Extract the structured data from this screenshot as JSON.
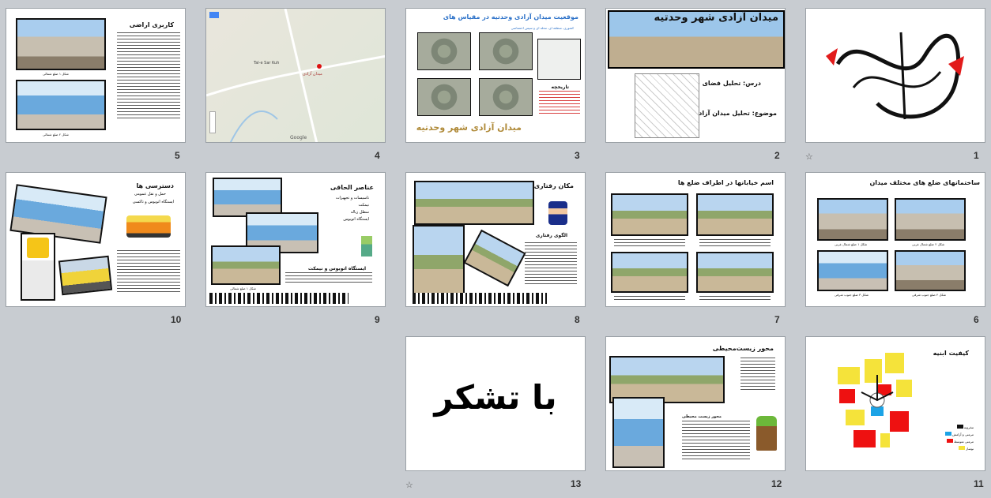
{
  "slides": [
    {
      "n": "1",
      "star": "☆"
    },
    {
      "n": "2",
      "title": "میدان آزادی شهر وحدتیه",
      "line1": "درس: تحلیل فضای شهری",
      "line2": "موضوع: تحلیل میدان آزادی شهر وحدتیه"
    },
    {
      "n": "3",
      "title": "موقعیت میدان آزادی وحدتیه در مقیاس های",
      "subtitle": "کشوری، منطقه ای، محله ای و سپس اختصاصی",
      "history": "تاریخچه",
      "bottom": "میدان آزادی شهر وحدتیه"
    },
    {
      "n": "4",
      "map_city": "Tal-e Sar Kuh",
      "map_pin": "میدان آزادی",
      "google": "Google"
    },
    {
      "n": "5",
      "title": "کاربری اراضی",
      "cap1": "شکل ۱ ضلع شمالی",
      "cap2": "شکل ۲ ضلع شمالی"
    },
    {
      "n": "6",
      "title": "ساختمانهای ضلع های مختلف میدان",
      "c1": "شکل ۱ ضلع شمال غربی",
      "c2": "شکل ۲ ضلع شمال غربی",
      "c3": "شکل ۳ ضلع جنوب شرقی",
      "c4": "شکل ۴ ضلع جنوب شرقی"
    },
    {
      "n": "7",
      "title": "اسم خیابانها در اطراف ضلع ها"
    },
    {
      "n": "8",
      "title": "مکان رفتاری",
      "sub": "الگوی رفتاری"
    },
    {
      "n": "9",
      "title": "عناصر الحاقی",
      "items": [
        "تاسیسات و تجهیزات",
        "نیمکت",
        "سطل زباله",
        "ایستگاه اتوبوس"
      ],
      "sub": "ایستگاه اتوبوس و نیمکت",
      "cap": "شکل ۱ ضلع شمالی"
    },
    {
      "n": "10",
      "title": "دسترسی ها",
      "sub1": "حمل و نقل عمومی",
      "sub2": "ایستگاه اتوبوس و تاکسی"
    },
    {
      "n": "11",
      "title": "کیفیت ابنیه",
      "legend": [
        "مخروبه",
        "مرمتی و آرامش",
        "مرمتی متوسط",
        "نوساز"
      ]
    },
    {
      "n": "12",
      "title": "محور زیست‌محیطی",
      "sub": "محور زیست محیطی"
    },
    {
      "n": "13",
      "big": "با تشکر",
      "star": "☆"
    }
  ]
}
